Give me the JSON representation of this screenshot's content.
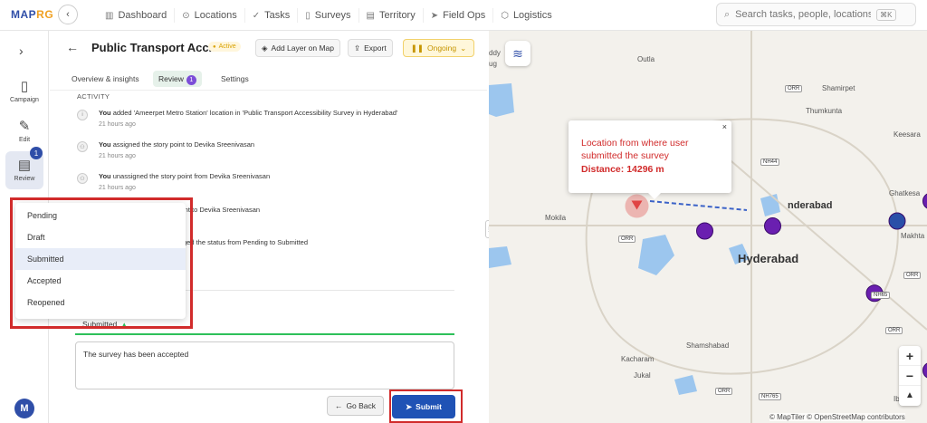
{
  "app": {
    "logo_main": "MAP",
    "logo_accent": "RG"
  },
  "nav": [
    "Dashboard",
    "Locations",
    "Tasks",
    "Surveys",
    "Territory",
    "Field Ops",
    "Logistics"
  ],
  "search": {
    "placeholder": "Search tasks, people, locations...",
    "shortcut": "⌘K"
  },
  "rail": {
    "campaign": "Campaign",
    "edit": "Edit",
    "review": "Review",
    "review_badge": "1",
    "avatar": "M"
  },
  "header": {
    "title": "Public Transport Acc...",
    "status": "Active",
    "add_layer": "Add Layer on Map",
    "export": "Export",
    "ongoing": "Ongoing"
  },
  "tabs": {
    "overview": "Overview & insights",
    "review": "Review",
    "review_badge": "1",
    "settings": "Settings"
  },
  "activity": {
    "heading": "ACTIVITY",
    "items": [
      {
        "actor": "You",
        "text": "added 'Ameerpet Metro Station' location in 'Public Transport Accessibility Survey in Hyderabad'",
        "time": "21 hours ago"
      },
      {
        "actor": "You",
        "text": "assigned the story point to Devika Sreenivasan",
        "time": "21 hours ago"
      },
      {
        "actor": "You",
        "text": "unassigned the story point from Devika Sreenivasan",
        "time": "21 hours ago"
      },
      {
        "actor": "",
        "text": "int to Devika Sreenivasan",
        "time": ""
      },
      {
        "actor": "",
        "text": "ged the status from Pending to Submitted",
        "time": ""
      }
    ]
  },
  "status_dropdown": {
    "options": [
      "Pending",
      "Draft",
      "Submitted",
      "Accepted",
      "Reopened"
    ],
    "highlighted": "Submitted"
  },
  "status_select": {
    "value": "Submitted"
  },
  "comment": {
    "value": "The survey has been accepted"
  },
  "buttons": {
    "go_back": "Go Back",
    "submit": "Submit"
  },
  "map": {
    "popup": {
      "line1": "Location from where user",
      "line2": "submitted the survey",
      "distance_label": "Distance:",
      "distance_value": "14296 m"
    },
    "labels": {
      "outla": "Outla",
      "shamirpet": "Shamirpet",
      "thumkunta": "Thumkunta",
      "keesara": "Keesara",
      "ghatkesar": "Ghatkesa",
      "mokila": "Mokila",
      "hyderabad": "Hyderabad",
      "secunderabad": "nderabad",
      "makhta": "Makhta",
      "shamshabad": "Shamshabad",
      "kacharam": "Kacharam",
      "jukal": "Jukal",
      "ibrahim": "Ibrahim",
      "ddy": "ddy",
      "ug": "ug"
    },
    "roads": {
      "orr1": "ORR",
      "orr2": "ORR",
      "orr3": "ORR",
      "orr4": "ORR",
      "orr5": "ORR",
      "nh44": "NH44",
      "nh65": "NH65",
      "nh765": "NH765"
    },
    "attribution": "© MapTiler © OpenStreetMap contributors",
    "markers": [
      {
        "lon": 78.285,
        "lat": 17.428,
        "kind": "survey"
      },
      {
        "lon": 78.315,
        "lat": 17.43,
        "kind": "survey"
      },
      {
        "lon": 78.37,
        "lat": 17.432,
        "kind": "selected"
      },
      {
        "lon": 78.385,
        "lat": 17.44,
        "kind": "survey"
      },
      {
        "lon": 78.41,
        "lat": 17.432,
        "kind": "survey"
      },
      {
        "lon": 78.36,
        "lat": 17.403,
        "kind": "survey"
      },
      {
        "lon": 78.395,
        "lat": 17.388,
        "kind": "survey"
      },
      {
        "lon": 78.385,
        "lat": 17.372,
        "kind": "survey"
      },
      {
        "lon": 78.428,
        "lat": 17.375,
        "kind": "survey"
      },
      {
        "lon": 78.452,
        "lat": 17.362,
        "kind": "survey"
      },
      {
        "lon": 78.385,
        "lat": 17.347,
        "kind": "survey"
      },
      {
        "lon": 78.255,
        "lat": 17.438,
        "kind": "user-location"
      }
    ],
    "colors": {
      "survey": "#6a1fb0",
      "selected": "#2a4fa8",
      "user": "#e04444"
    }
  }
}
